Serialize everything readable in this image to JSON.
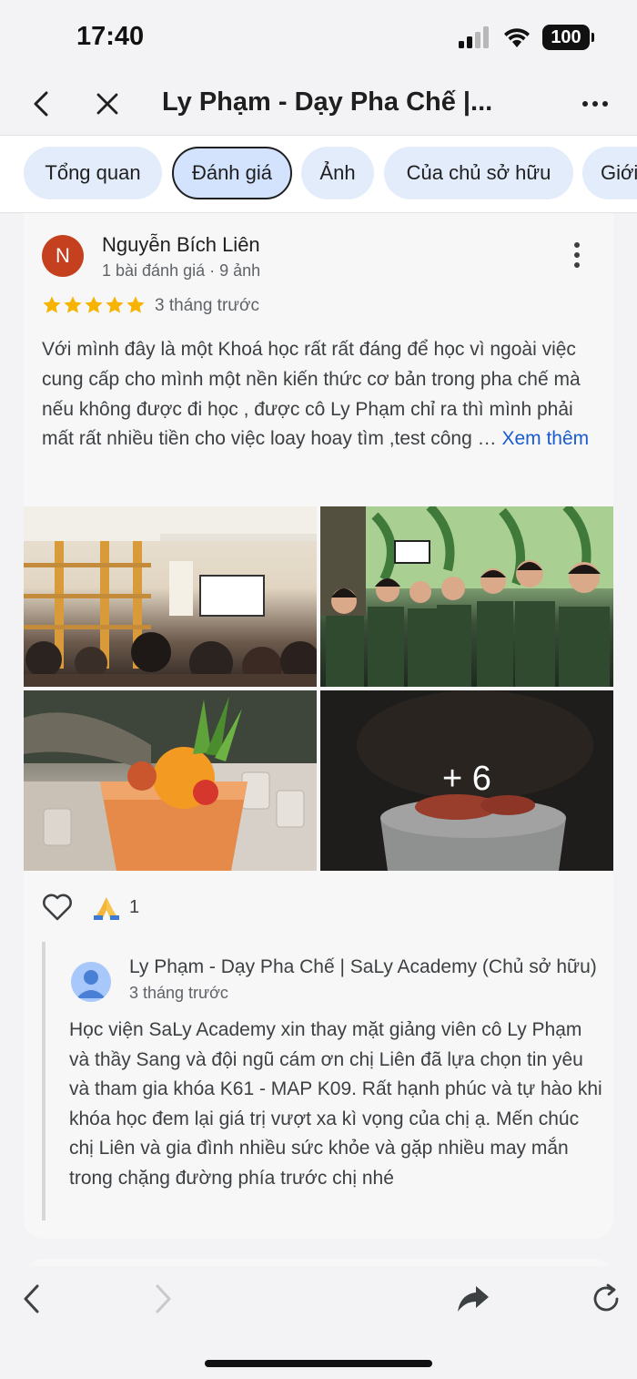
{
  "status_bar": {
    "time": "17:40",
    "battery": "100",
    "icons": [
      "signal-icon",
      "wifi-icon",
      "battery-icon"
    ]
  },
  "header": {
    "back_icon": "chevron-left-icon",
    "close_icon": "close-icon",
    "title": "Ly Phạm - Dạy Pha Chế |...",
    "more_icon": "more-horizontal-icon"
  },
  "tabs": [
    {
      "label": "Tổng quan",
      "active": false
    },
    {
      "label": "Đánh giá",
      "active": true
    },
    {
      "label": "Ảnh",
      "active": false
    },
    {
      "label": "Của chủ sở hữu",
      "active": false
    },
    {
      "label": "Giới",
      "active": false
    }
  ],
  "review": {
    "avatar_letter": "N",
    "reviewer_name": "Nguyễn Bích Liên",
    "reviewer_meta": "1 bài đánh giá · 9 ảnh",
    "rating": 5,
    "max_rating": 5,
    "time": "3 tháng trước",
    "text": "Với mình đây là một Khoá học rất rất đáng để học vì ngoài việc cung cấp cho mình một nền kiến thức cơ bản trong pha chế mà nếu không được đi học , được cô Ly Phạm chỉ ra thì mình phải mất rất nhiều tiền cho việc loay hoay tìm ,test công …",
    "see_more": "Xem thêm",
    "more_photos": "+ 6",
    "reaction_count": "1",
    "colors": {
      "star": "#f6b400",
      "avatar": "#c5401f",
      "link": "#1a5bd0"
    }
  },
  "owner_reply": {
    "name": "Ly Phạm - Dạy Pha Chế | SaLy Academy (Chủ sở hữu)",
    "time": "3 tháng trước",
    "text": "Học viện SaLy Academy xin thay mặt giảng viên cô Ly Phạm và thầy Sang và đội ngũ cám ơn chị Liên đã lựa chọn tin yêu và tham gia khóa K61 - MAP K09. Rất hạnh phúc và tự hào khi khóa học đem lại giá trị vượt xa kì vọng của chị ạ. Mến chúc chị Liên và gia đình nhiều sức khỏe và gặp nhiều may mắn trong chặng đường phía trước chị nhé"
  },
  "bottom_nav": {
    "icons": [
      "back-arrow-icon",
      "forward-arrow-icon",
      "share-icon",
      "reload-icon"
    ]
  }
}
